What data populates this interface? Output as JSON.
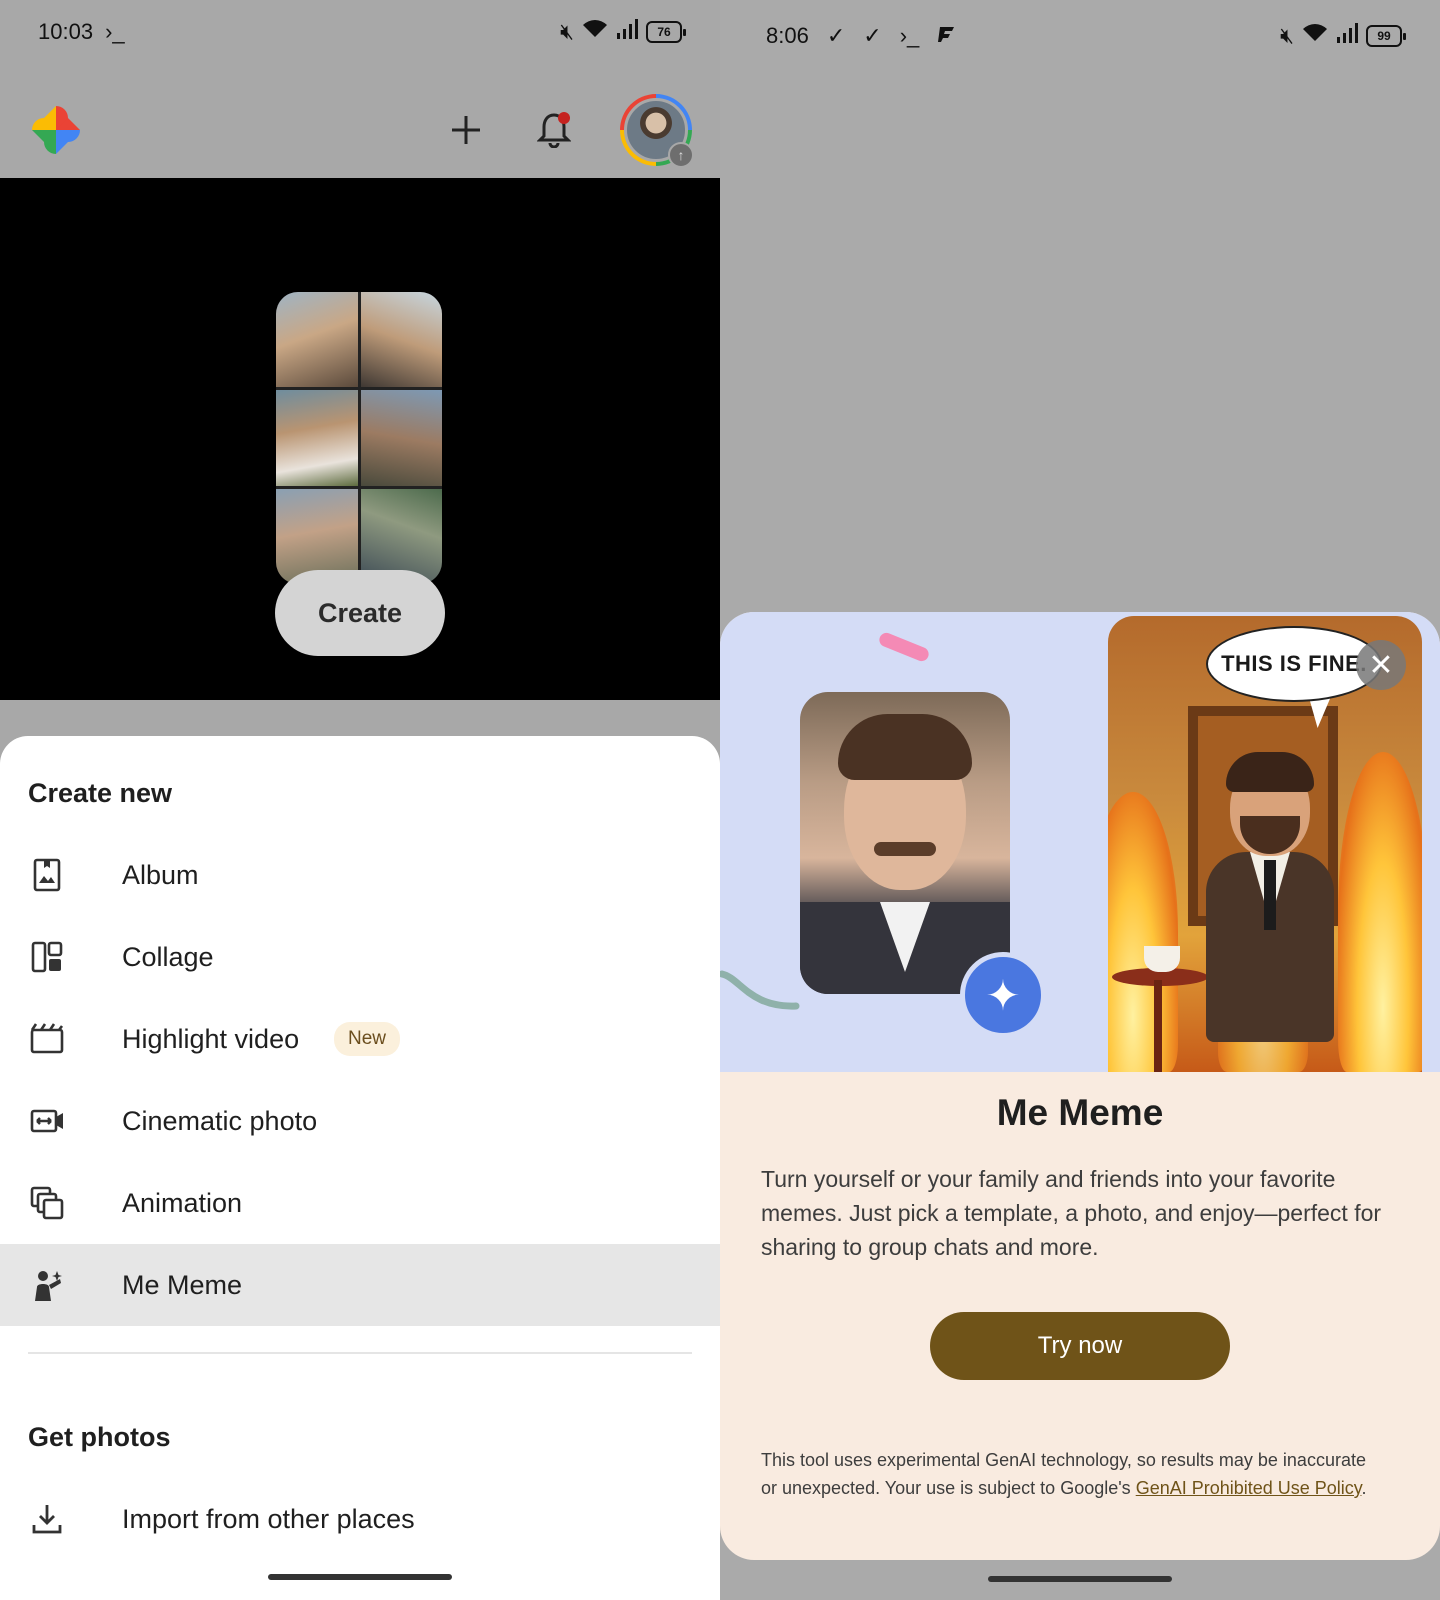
{
  "left": {
    "status": {
      "time": "10:03",
      "terminal_glyph": "›_",
      "battery": "76"
    },
    "header": {
      "add_icon": "plus-icon",
      "bell_icon": "bell-icon"
    },
    "promo": {
      "create_label": "Create"
    },
    "sheet": {
      "create_new_title": "Create new",
      "items": [
        {
          "label": "Album",
          "icon": "album-icon"
        },
        {
          "label": "Collage",
          "icon": "collage-icon"
        },
        {
          "label": "Highlight video",
          "icon": "clapperboard-icon",
          "badge": "New"
        },
        {
          "label": "Cinematic photo",
          "icon": "cinematic-icon"
        },
        {
          "label": "Animation",
          "icon": "animation-icon"
        },
        {
          "label": "Me Meme",
          "icon": "me-meme-icon"
        }
      ],
      "get_photos_title": "Get photos",
      "import_label": "Import from other places"
    }
  },
  "right": {
    "status": {
      "time": "8:06",
      "check_glyph": "✓",
      "terminal_glyph": "›_",
      "battery": "99"
    },
    "card": {
      "bubble_text": "THIS IS FINE.",
      "title": "Me Meme",
      "description": "Turn yourself or your family and friends into your favorite memes. Just pick a template, a photo, and enjoy—perfect for sharing to group chats and more.",
      "try_label": "Try now",
      "disclaimer_text": "This tool uses experimental GenAI technology, so results may be inaccurate or unexpected. Your use is subject to Google's ",
      "policy_link": "GenAI Prohibited Use Policy",
      "disclaimer_end": "."
    }
  },
  "colors": {
    "accent_brown": "#6f5318",
    "card_bg": "#f9ebe0",
    "art_bg": "#d4dcf6",
    "badge_bg": "#fbf0dc"
  }
}
